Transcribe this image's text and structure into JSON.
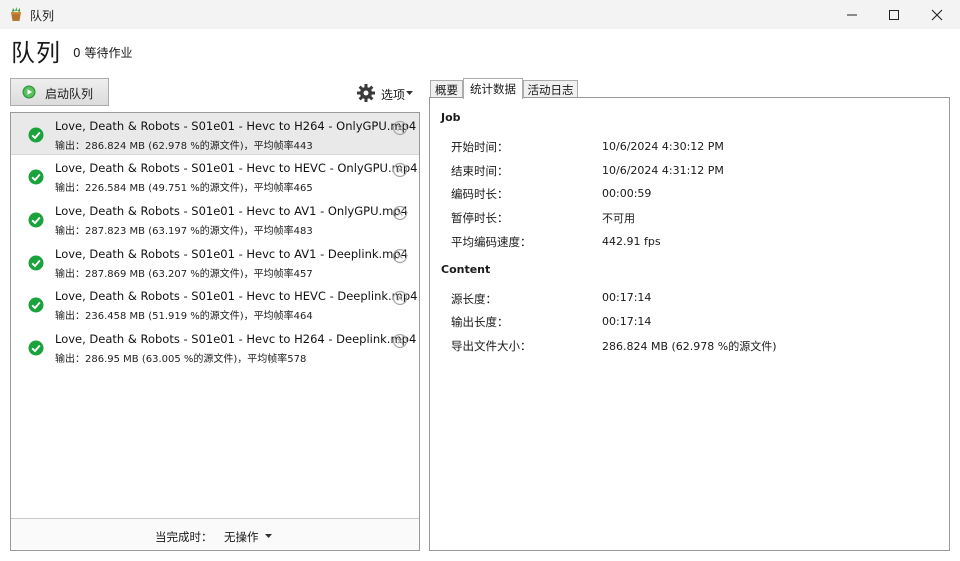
{
  "window": {
    "title": "队列"
  },
  "header": {
    "title": "队列",
    "waiting": "0 等待作业"
  },
  "toolbar": {
    "start_label": "启动队列",
    "options_label": "选项"
  },
  "queue": {
    "items": [
      {
        "name": "Love, Death & Robots - S01e01 - Hevc to H264 - OnlyGPU.mp4",
        "detail": "输出：286.824 MB (62.978 %的源文件)，平均帧率443",
        "selected": true
      },
      {
        "name": "Love, Death & Robots - S01e01 - Hevc to HEVC - OnlyGPU.mp4",
        "detail": "输出：226.584 MB (49.751 %的源文件)，平均帧率465",
        "selected": false
      },
      {
        "name": "Love, Death & Robots - S01e01 - Hevc to AV1 - OnlyGPU.mp4",
        "detail": "输出：287.823 MB (63.197 %的源文件)，平均帧率483",
        "selected": false
      },
      {
        "name": "Love, Death & Robots - S01e01 - Hevc to AV1 - Deeplink.mp4",
        "detail": "输出：287.869 MB (63.207 %的源文件)，平均帧率457",
        "selected": false
      },
      {
        "name": "Love, Death & Robots - S01e01 - Hevc to HEVC - Deeplink.mp4",
        "detail": "输出：236.458 MB (51.919 %的源文件)，平均帧率464",
        "selected": false
      },
      {
        "name": "Love, Death & Robots - S01e01 - Hevc to H264 - Deeplink.mp4",
        "detail": "输出：286.95 MB (63.005 %的源文件)，平均帧率578",
        "selected": false
      }
    ],
    "footer_label": "当完成时：",
    "footer_value": "无操作"
  },
  "tabs": [
    {
      "label": "概要"
    },
    {
      "label": "统计数据"
    },
    {
      "label": "活动日志"
    }
  ],
  "stats": {
    "job_title": "Job",
    "job_rows": [
      {
        "label": "开始时间：",
        "value": "10/6/2024 4:30:12 PM"
      },
      {
        "label": "结束时间：",
        "value": "10/6/2024 4:31:12 PM"
      },
      {
        "label": "编码时长：",
        "value": "00:00:59"
      },
      {
        "label": "暂停时长：",
        "value": "不可用"
      },
      {
        "label": "平均编码速度：",
        "value": "442.91 fps"
      }
    ],
    "content_title": "Content",
    "content_rows": [
      {
        "label": "源长度：",
        "value": "00:17:14"
      },
      {
        "label": "输出长度：",
        "value": "00:17:14"
      },
      {
        "label": "导出文件大小：",
        "value": "286.824 MB (62.978 %的源文件)"
      }
    ]
  },
  "colors": {
    "check": "#1aa33c",
    "play": "#2e9a3a"
  }
}
